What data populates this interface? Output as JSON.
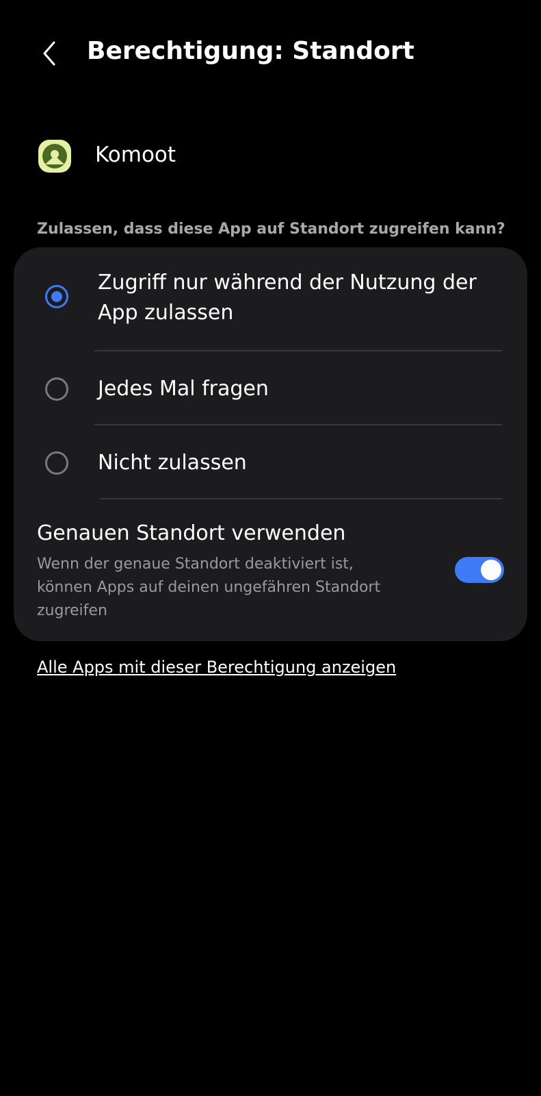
{
  "header": {
    "title": "Berechtigung: Standort",
    "back_icon": "chevron-left-icon"
  },
  "app": {
    "name": "Komoot",
    "icon": "komoot-app-icon",
    "icon_color": "#e6f0a3"
  },
  "question": "Zulassen, dass diese App auf Standort zugreifen kann?",
  "options": [
    {
      "label": "Zugriff nur während der Nutzung der App zulassen",
      "selected": true
    },
    {
      "label": "Jedes Mal fragen",
      "selected": false
    },
    {
      "label": "Nicht zulassen",
      "selected": false
    }
  ],
  "precise_location": {
    "title": "Genauen Standort verwenden",
    "description": "Wenn der genaue Standort deaktiviert ist, können Apps auf deinen ungefähren Standort zugreifen",
    "enabled": true
  },
  "all_apps_link": "Alle Apps mit dieser Berechtigung anzeigen",
  "colors": {
    "accent": "#3e7bf5",
    "background": "#000000",
    "card": "#1c1c1e"
  }
}
